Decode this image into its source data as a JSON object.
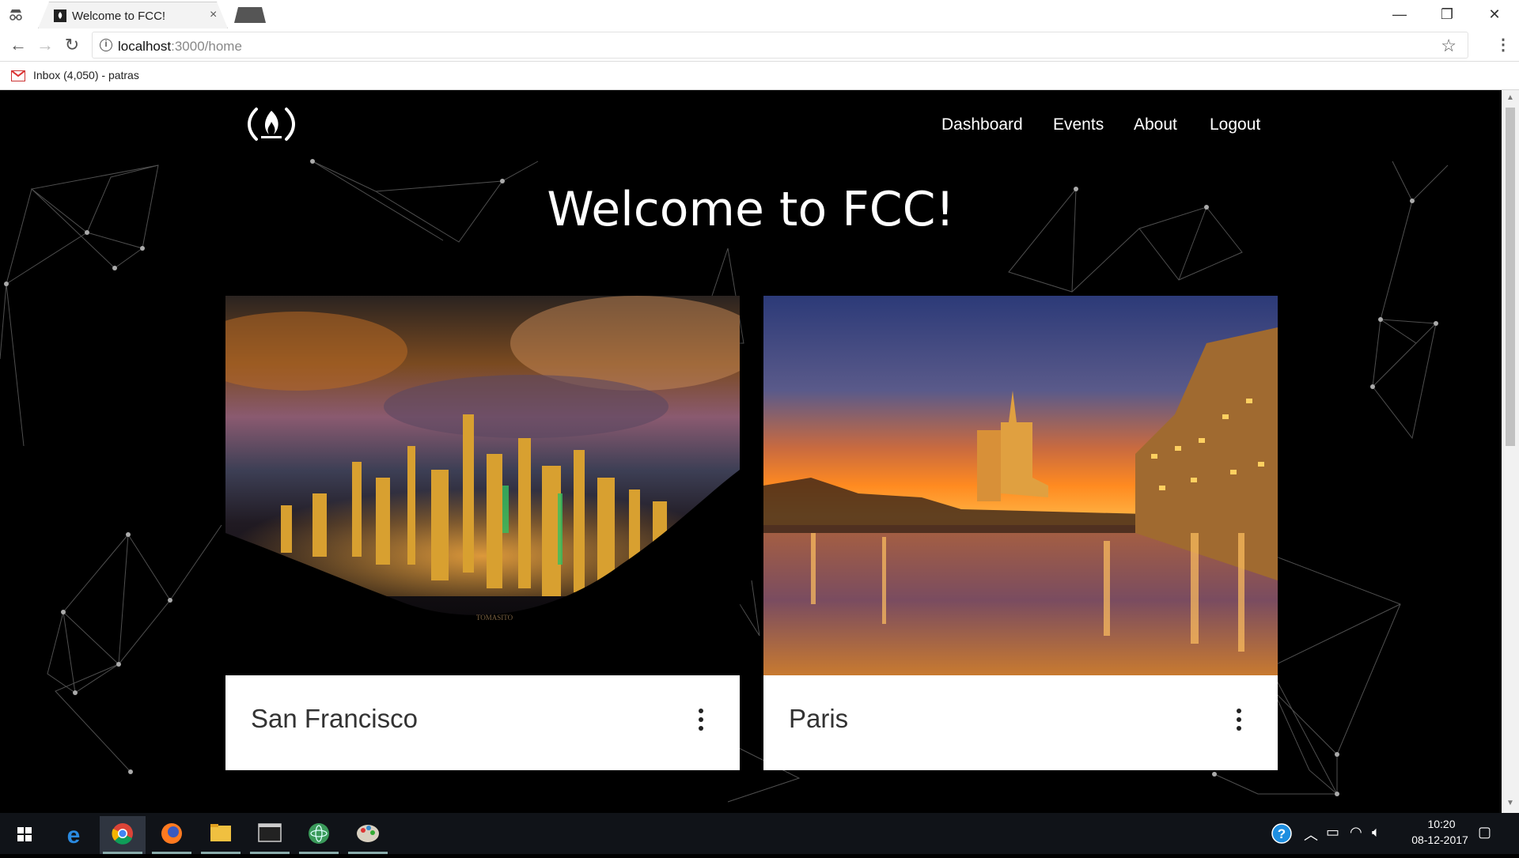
{
  "browser": {
    "tab_title": "Welcome to FCC!",
    "tab_close": "×",
    "url_host": "localhost",
    "url_path": ":3000/home",
    "bookmark_label": "Inbox (4,050) - patras",
    "window_controls": {
      "minimize": "—",
      "restore": "❐",
      "close": "✕"
    }
  },
  "nav": {
    "links": [
      "Dashboard",
      "Events",
      "About",
      "Logout"
    ]
  },
  "hero": {
    "title": "Welcome to FCC!"
  },
  "cards": [
    {
      "title": "San Francisco",
      "image_watermark": "TOMASITO"
    },
    {
      "title": "Paris"
    }
  ],
  "taskbar": {
    "apps": [
      "windows-start",
      "edge",
      "chrome",
      "firefox",
      "file-explorer",
      "terminal",
      "atom",
      "paint"
    ],
    "time": "10:20",
    "date": "08-12-2017"
  },
  "colors": {
    "page_bg": "#000000",
    "nav_text": "#ffffff",
    "card_bg": "#ffffff"
  }
}
